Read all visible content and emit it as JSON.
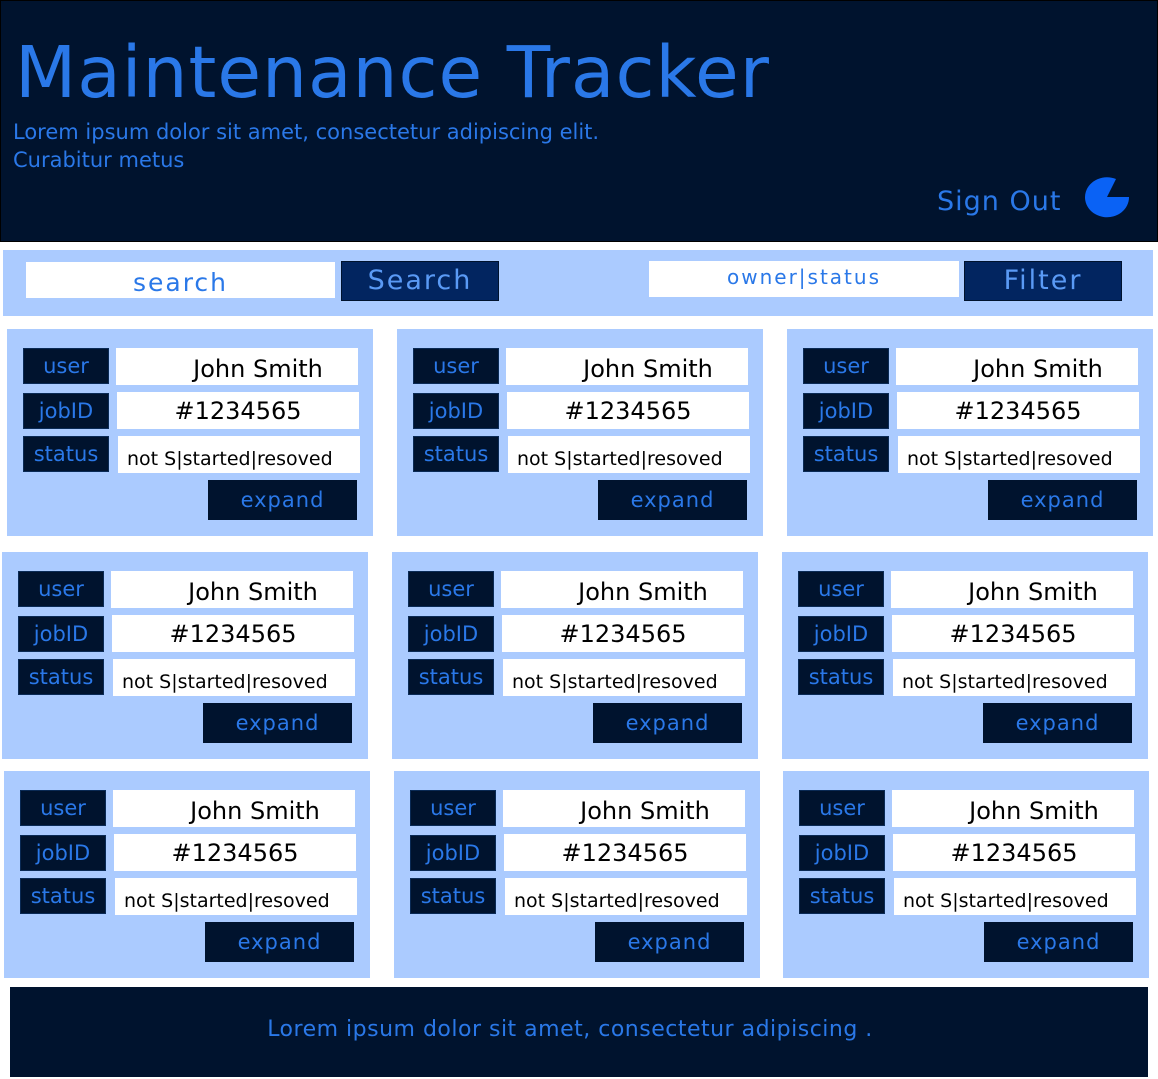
{
  "header": {
    "title": "Maintenance Tracker",
    "subtitle_line1": "Lorem ipsum dolor sit amet, consectetur adipiscing elit.",
    "subtitle_line2": "Curabitur metus",
    "signout_label": "Sign Out",
    "signout_icon": "pie-icon"
  },
  "toolbar": {
    "search_placeholder": "search",
    "search_button": "Search",
    "filter_placeholder": "owner|status",
    "filter_button": "Filter"
  },
  "cards": [
    {
      "user_label": "user",
      "user": "John Smith",
      "job_label": "jobID",
      "job": "#1234565",
      "status_label": "status",
      "status": "not S|started|resoved",
      "expand": "expand"
    },
    {
      "user_label": "user",
      "user": "John Smith",
      "job_label": "jobID",
      "job": "#1234565",
      "status_label": "status",
      "status": "not S|started|resoved",
      "expand": "expand"
    },
    {
      "user_label": "user",
      "user": "John Smith",
      "job_label": "jobID",
      "job": "#1234565",
      "status_label": "status",
      "status": "not S|started|resoved",
      "expand": "expand"
    },
    {
      "user_label": "user",
      "user": "John Smith",
      "job_label": "jobID",
      "job": "#1234565",
      "status_label": "status",
      "status": "not S|started|resoved",
      "expand": "expand"
    },
    {
      "user_label": "user",
      "user": "John Smith",
      "job_label": "jobID",
      "job": "#1234565",
      "status_label": "status",
      "status": "not S|started|resoved",
      "expand": "expand"
    },
    {
      "user_label": "user",
      "user": "John Smith",
      "job_label": "jobID",
      "job": "#1234565",
      "status_label": "status",
      "status": "not S|started|resoved",
      "expand": "expand"
    },
    {
      "user_label": "user",
      "user": "John Smith",
      "job_label": "jobID",
      "job": "#1234565",
      "status_label": "status",
      "status": "not S|started|resoved",
      "expand": "expand"
    },
    {
      "user_label": "user",
      "user": "John Smith",
      "job_label": "jobID",
      "job": "#1234565",
      "status_label": "status",
      "status": "not S|started|resoved",
      "expand": "expand"
    },
    {
      "user_label": "user",
      "user": "John Smith",
      "job_label": "jobID",
      "job": "#1234565",
      "status_label": "status",
      "status": "not S|started|resoved",
      "expand": "expand"
    }
  ],
  "footer": {
    "text": "Lorem ipsum dolor sit amet, consectetur adipiscing ."
  },
  "colors": {
    "header_bg": "#00132e",
    "accent_text": "#2a78e8",
    "panel_bg": "#abcbff",
    "button_bg": "#022560"
  }
}
